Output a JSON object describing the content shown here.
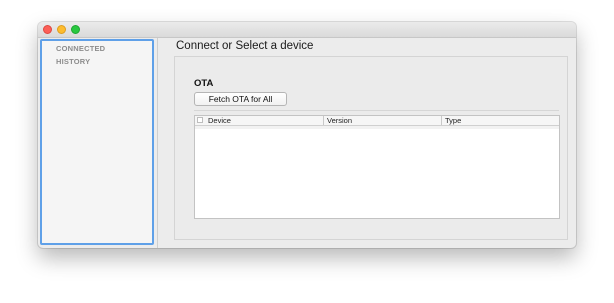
{
  "sidebar": {
    "items": [
      {
        "label": "CONNECTED"
      },
      {
        "label": "HISTORY"
      }
    ]
  },
  "main": {
    "title": "Connect or Select a device",
    "ota": {
      "heading": "OTA",
      "fetch_button": "Fetch OTA for All",
      "table": {
        "columns": [
          "Device",
          "Version",
          "Type"
        ],
        "rows": []
      }
    }
  },
  "colors": {
    "sidebar_focus_border": "#5fa0e8",
    "close": "#fc5f57",
    "minimize": "#fdbc2e",
    "maximize": "#29c840"
  },
  "icons": [
    "close-traffic-light",
    "minimize-traffic-light",
    "maximize-traffic-light"
  ]
}
